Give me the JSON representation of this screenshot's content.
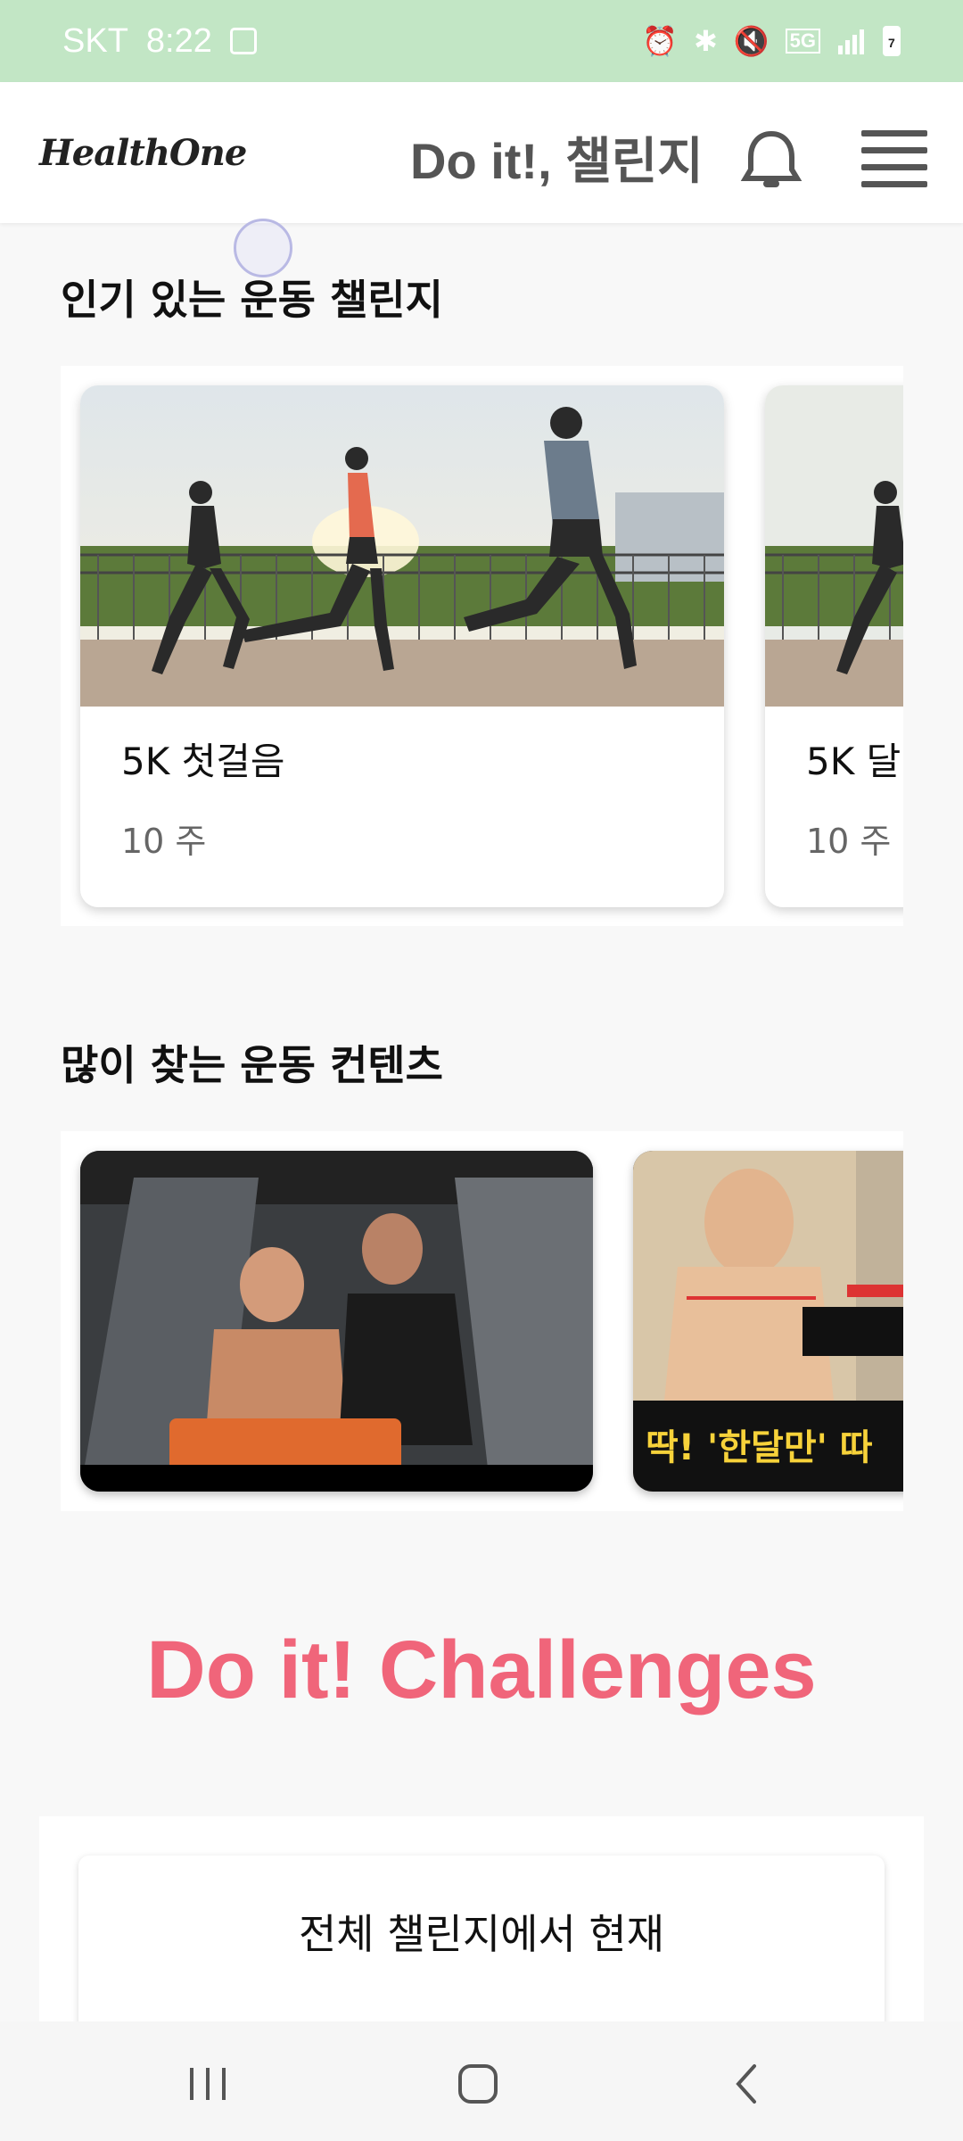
{
  "status_bar": {
    "carrier": "SKT",
    "time": "8:22",
    "network": "5G",
    "battery": "7"
  },
  "app_bar": {
    "logo": "HealthOne",
    "title": "Do it!, 챌린지",
    "icons": [
      "bell-icon",
      "menu-icon"
    ]
  },
  "popular_challenges": {
    "heading": "인기 있는 운동 챌린지",
    "cards": [
      {
        "name": "5K 첫걸음",
        "duration": "10 주",
        "image": "runners-photo"
      },
      {
        "name": "5K 달",
        "duration": "10 주",
        "image": "runners-photo"
      }
    ]
  },
  "popular_contents": {
    "heading": "많이 찾는 운동 컨텐츠",
    "videos": [
      {
        "image": "gym-trainers-thumbnail"
      },
      {
        "image": "shoulder-workout-thumbnail",
        "overlay_text": "딱! '한달만' 따"
      }
    ]
  },
  "challenges_banner": {
    "title": "Do it! Challenges",
    "color": "#f0657a"
  },
  "all_challenges": {
    "text": "전체 챌린지에서 현재"
  },
  "nav_bar": {
    "icons": [
      "recent-apps-icon",
      "home-icon",
      "back-icon"
    ]
  },
  "colors": {
    "status_bar_bg": "#c2e6c5",
    "accent": "#f0657a"
  }
}
